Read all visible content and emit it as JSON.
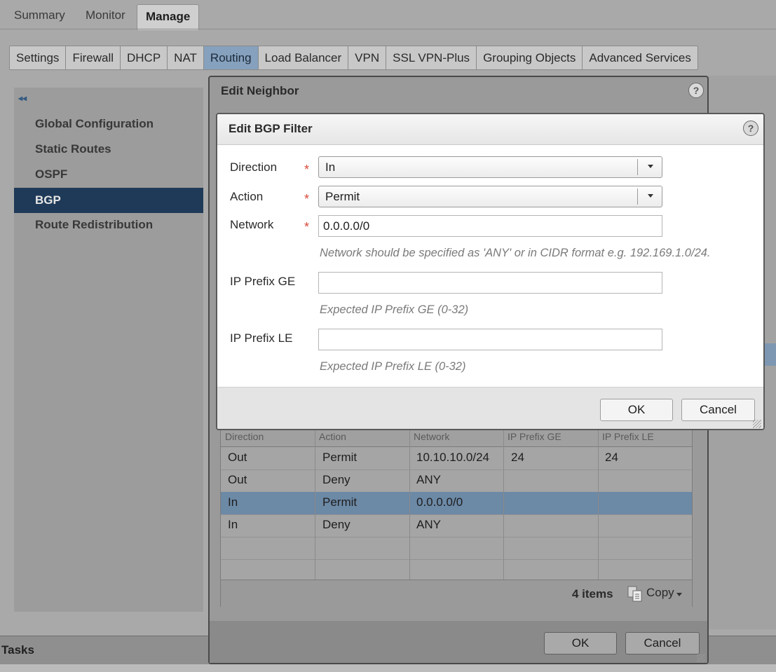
{
  "top_tabs": [
    "Summary",
    "Monitor",
    "Manage"
  ],
  "sub_tabs": [
    "Settings",
    "Firewall",
    "DHCP",
    "NAT",
    "Routing",
    "Load Balancer",
    "VPN",
    "SSL VPN-Plus",
    "Grouping Objects",
    "Advanced Services"
  ],
  "nav": {
    "collapse_icon": "◂◂",
    "items": [
      "Global Configuration",
      "Static Routes",
      "OSPF",
      "BGP",
      "Route Redistribution"
    ],
    "active": "BGP"
  },
  "tasks_label": "Tasks",
  "neighbor_dialog": {
    "title": "Edit Neighbor",
    "help": "?",
    "grid": {
      "columns": [
        "Direction",
        "Action",
        "Network",
        "IP Prefix GE",
        "IP Prefix LE"
      ],
      "rows": [
        [
          "Out",
          "Permit",
          "10.10.10.0/24",
          "24",
          "24"
        ],
        [
          "Out",
          "Deny",
          "ANY",
          "",
          ""
        ],
        [
          "In",
          "Permit",
          "0.0.0.0/0",
          "",
          ""
        ],
        [
          "In",
          "Deny",
          "ANY",
          "",
          ""
        ]
      ],
      "count": "4 items",
      "copy_label": "Copy"
    },
    "ok": "OK",
    "cancel": "Cancel"
  },
  "filter_dialog": {
    "title": "Edit BGP Filter",
    "help": "?",
    "required_mark": "*",
    "direction": {
      "label": "Direction",
      "value": "In"
    },
    "action": {
      "label": "Action",
      "value": "Permit"
    },
    "network": {
      "label": "Network",
      "value": "0.0.0.0/0",
      "hint": "Network should be specified as 'ANY' or in CIDR format e.g. 192.169.1.0/24."
    },
    "prefix_ge": {
      "label": "IP Prefix GE",
      "value": "",
      "hint": "Expected IP Prefix GE (0-32)"
    },
    "prefix_le": {
      "label": "IP Prefix LE",
      "value": "",
      "hint": "Expected IP Prefix LE (0-32)"
    },
    "ok": "OK",
    "cancel": "Cancel"
  }
}
